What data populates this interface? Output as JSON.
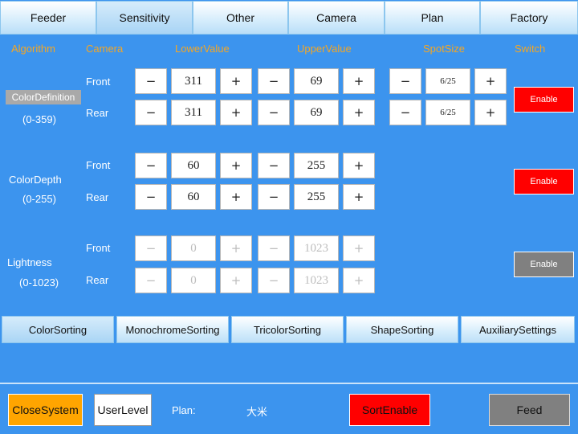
{
  "top_tabs": [
    "Feeder",
    "Sensitivity",
    "Other",
    "Camera",
    "Plan",
    "Factory"
  ],
  "headers": {
    "algorithm": "Algorithm",
    "camera": "Camera",
    "lower": "LowerValue",
    "upper": "UpperValue",
    "spot": "SpotSize",
    "switch": "Switch"
  },
  "minus": "−",
  "plus": "+",
  "groups": [
    {
      "name": "ColorDefinition",
      "range": "(0-359)",
      "switch": "Enable",
      "front": {
        "label": "Front",
        "lower": "311",
        "upper": "69",
        "spot": "6/25"
      },
      "rear": {
        "label": "Rear",
        "lower": "311",
        "upper": "69",
        "spot": "6/25"
      }
    },
    {
      "name": "ColorDepth",
      "range": "(0-255)",
      "switch": "Enable",
      "front": {
        "label": "Front",
        "lower": "60",
        "upper": "255"
      },
      "rear": {
        "label": "Rear",
        "lower": "60",
        "upper": "255"
      }
    },
    {
      "name": "Lightness",
      "range": "(0-1023)",
      "switch": "Enable",
      "front": {
        "label": "Front",
        "lower": "0",
        "upper": "1023"
      },
      "rear": {
        "label": "Rear",
        "lower": "0",
        "upper": "1023"
      }
    }
  ],
  "sub_tabs": [
    "ColorSorting",
    "MonochromeSorting",
    "TricolorSorting",
    "ShapeSorting",
    "AuxiliarySettings"
  ],
  "bottom": {
    "close": "CloseSystem",
    "user": "UserLevel",
    "plan_label": "Plan:",
    "plan_value": "大米",
    "sort": "SortEnable",
    "feed": "Feed"
  },
  "colors": {
    "background": "#3c94ee",
    "header": "#f5a623",
    "enable_red": "#ff0000",
    "enable_gray": "#808080",
    "close_orange": "#ffa500"
  }
}
